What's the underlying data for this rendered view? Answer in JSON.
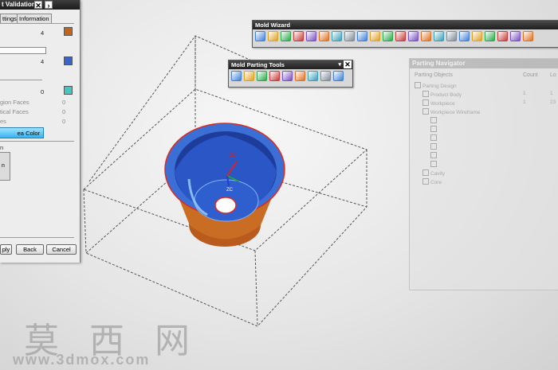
{
  "dialog": {
    "title": "t Validation",
    "tabs": [
      "ttings",
      "Information"
    ],
    "row1_value": "4",
    "row2_value": "4",
    "row3_value": "0",
    "labels": [
      {
        "text": "gion Faces",
        "value": "0"
      },
      {
        "text": "tical Faces",
        "value": "0"
      },
      {
        "text": "es",
        "value": "0"
      }
    ],
    "area_button": "ea Color",
    "section_label": "n",
    "box_label": "n",
    "buttons": {
      "apply": "ply",
      "back": "Back",
      "cancel": "Cancel"
    },
    "colors": {
      "swatch1": "#c0651a",
      "swatch2": "#3a64c8",
      "swatch3": "#45c7c0"
    }
  },
  "mold_wizard": {
    "title": "Mold Wizard",
    "icon_names": [
      "initialize-project-icon",
      "mold-csys-icon",
      "shrinkage-icon",
      "workpiece-icon",
      "cavity-layout-icon",
      "family-mold-icon",
      "patch-tools-icon",
      "parting-tools-icon",
      "mold-base-icon",
      "standard-parts-icon",
      "ejector-pin-icon",
      "slider-lifter-icon",
      "sub-insert-icon",
      "gate-icon",
      "runner-icon",
      "cooling-icon",
      "electrode-icon",
      "trim-mold-icon",
      "pocket-icon",
      "bom-icon",
      "drawing-icon",
      "view-manager-icon"
    ]
  },
  "parting_tools": {
    "title": "Mold Parting Tools",
    "icon_names": [
      "region-analysis-icon",
      "mold-csys-icon",
      "product-validation-icon",
      "parting-line-icon",
      "parting-surface-icon",
      "define-regions-icon",
      "define-cavity-icon",
      "swap-model-icon",
      "parting-navigator-icon"
    ]
  },
  "navigator": {
    "title": "Parting Navigator",
    "headers": {
      "objects": "Parting Objects",
      "count": "Count",
      "lo": "Lo"
    },
    "rows": [
      {
        "label": "Parting Design",
        "count": "",
        "lo": "",
        "indent": 0
      },
      {
        "label": "Product Body",
        "count": "1",
        "lo": "1",
        "indent": 1
      },
      {
        "label": "Workpiece",
        "count": "1",
        "lo": "23",
        "indent": 1
      },
      {
        "label": "Workpiece Wireframe",
        "count": "",
        "lo": "",
        "indent": 1
      },
      {
        "label": "",
        "count": "",
        "lo": "",
        "indent": 2
      },
      {
        "label": "",
        "count": "",
        "lo": "",
        "indent": 2
      },
      {
        "label": "",
        "count": "",
        "lo": "",
        "indent": 2
      },
      {
        "label": "",
        "count": "",
        "lo": "",
        "indent": 2
      },
      {
        "label": "",
        "count": "",
        "lo": "",
        "indent": 2
      },
      {
        "label": "",
        "count": "",
        "lo": "",
        "indent": 2
      },
      {
        "label": "Cavity",
        "count": "",
        "lo": "",
        "indent": 1
      },
      {
        "label": "Core",
        "count": "",
        "lo": "",
        "indent": 1
      }
    ]
  },
  "viewport": {
    "axis_zc": "ZC",
    "axis_xc": "ZC"
  },
  "watermark": {
    "cn": "莫 西 网",
    "url": "www.3dmox.com"
  }
}
